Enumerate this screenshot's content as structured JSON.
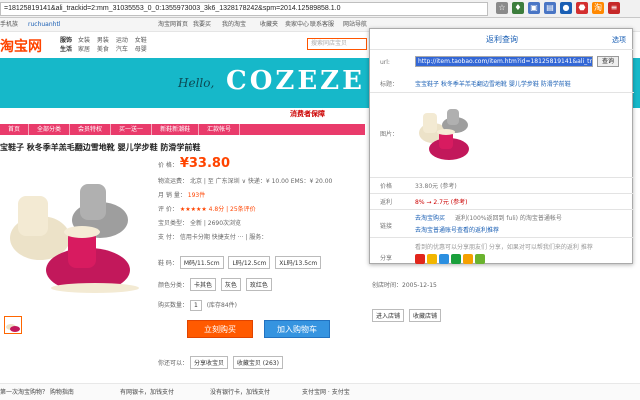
{
  "browser": {
    "url": "=18125819141&ali_trackid=2:mm_31035553_0_0:1355973003_3k6_1328178242&spm=2014.12589858.1.0"
  },
  "topnav": {
    "mobile": "手机族",
    "user": "ruchuanhtl",
    "links": [
      "淘宝网首页",
      "我要买",
      "我的淘宝",
      "收藏夹",
      "卖家中心",
      "联系客服",
      "网站导航"
    ]
  },
  "header": {
    "logo": "淘宝网",
    "cat_rows": [
      {
        "head": "服饰",
        "items": [
          "女装",
          "男装",
          "运动",
          "女鞋"
        ]
      },
      {
        "head": "生活",
        "items": [
          "家居",
          "美食",
          "汽车",
          "母婴"
        ]
      }
    ],
    "search_placeholder": "搜索同店宝贝"
  },
  "banner": {
    "hello": "Hello,",
    "brand": "COZEZE"
  },
  "storenav": {
    "menu": [
      "首页",
      "全部分类",
      "会员特权",
      "买一送一",
      "新鞋新潮鞋",
      "汇款帐号"
    ],
    "guarantee": "消费者保障"
  },
  "product": {
    "title": "宝鞋子 秋冬季羊羔毛翻边雪地靴 婴儿学步鞋 防滑学前鞋",
    "price_label": "价   格：",
    "price": "¥33.80",
    "shipping_label": "物流运费：",
    "shipping": "北京 | 至 广东深圳 ∨   快递：¥ 10.00   EMS：¥ 20.00",
    "sales_label": "月 销 量：",
    "sales": "193件",
    "rating_label": "评     价：",
    "rating": "★★★★★ 4.8分  |  25条评价",
    "points_label": "宝贝类型：",
    "points": "全新 | 2690次浏览",
    "payment_label": "支     付：",
    "payment": "信用卡分期  快捷支付  ···  |  服务：",
    "size_label": "鞋    码：",
    "sizes": [
      "M码/11.5cm",
      "L码/12.5cm",
      "XL码/13.5cm"
    ],
    "color_label": "颜色分类：",
    "colors": [
      "卡其色",
      "灰色",
      "玫红色"
    ],
    "qty_label": "购买数量：",
    "qty": "1",
    "stock": "(库存84件)",
    "buy": "立刻购买",
    "cart": "加入购物车",
    "share_label": "你还可以：",
    "share": "分享收宝贝",
    "collect": "收藏宝贝 (263)"
  },
  "rightcol": {
    "since": "创店时间：2005-12-15",
    "enter": "进入店铺",
    "collect": "收藏店铺"
  },
  "bottom": {
    "items": [
      "第一次淘宝购物？ 购物指南",
      "有网银卡，加钱支付",
      "没有银行卡，加钱支付",
      "支付宝网 · 支付宝"
    ]
  },
  "popup": {
    "title": "返利查询",
    "options": "选项",
    "url_label": "url:",
    "url_value": "http://item.taobao.com/item.htm?id=18125819141&ali_track",
    "query_btn": "查询",
    "title_label": "标题：",
    "item_title": "宝宝鞋子 秋冬季羊羔毛翻边雪地靴 婴儿学步鞋 防滑学前鞋",
    "image_label": "图片：",
    "price_label": "价格",
    "price_value": "33.80元 (参考)",
    "rebate_label": "返利",
    "rebate_value": "8% → 2.7元 (参考)",
    "link_label": "链接",
    "link1": "去淘宝购买",
    "link1_note": "返利(100%返回到 fuli) 的淘宝普通帐号",
    "link2": "去淘宝普通账号查看的返利推荐",
    "share_label": "分享",
    "share_note": "看到的优惠可以分享朋友们 分享，如果对可以帮我们来的返利 推荐",
    "share_colors": [
      "#e1261c",
      "#f2b600",
      "#2b8fe0",
      "#1aa03c",
      "#f5a000",
      "#6ab32e"
    ]
  }
}
